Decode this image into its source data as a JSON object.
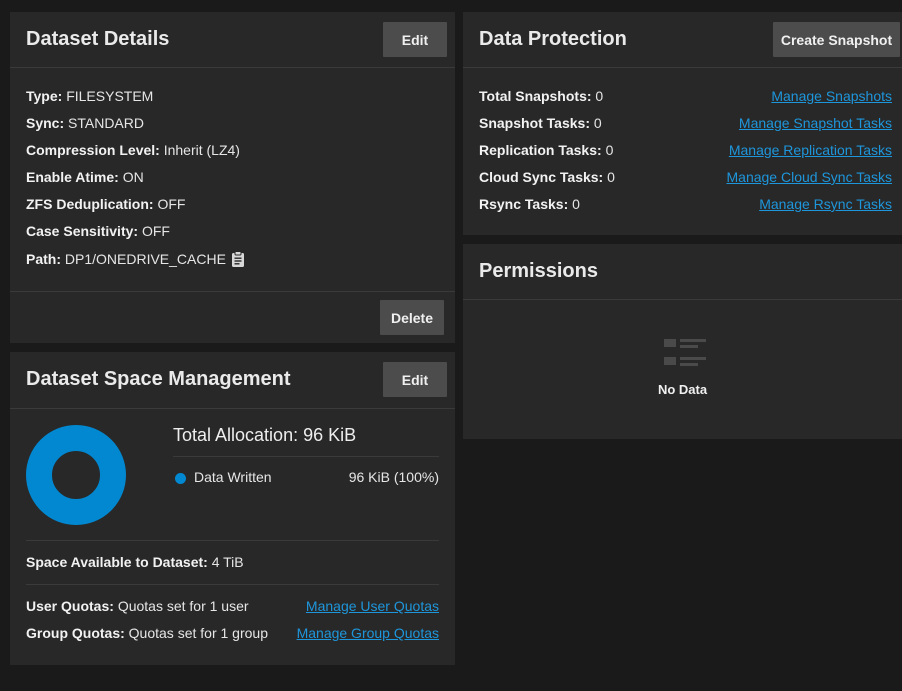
{
  "details": {
    "title": "Dataset Details",
    "edit_label": "Edit",
    "delete_label": "Delete",
    "rows": [
      {
        "label": "Type:",
        "value": "FILESYSTEM"
      },
      {
        "label": "Sync:",
        "value": "STANDARD"
      },
      {
        "label": "Compression Level:",
        "value": "Inherit (LZ4)"
      },
      {
        "label": "Enable Atime:",
        "value": "ON"
      },
      {
        "label": "ZFS Deduplication:",
        "value": "OFF"
      },
      {
        "label": "Case Sensitivity:",
        "value": "OFF"
      },
      {
        "label": "Path:",
        "value": "DP1/ONEDRIVE_CACHE"
      }
    ]
  },
  "space": {
    "title": "Dataset Space Management",
    "edit_label": "Edit",
    "total_label": "Total Allocation:",
    "total_value": "96 KiB",
    "legend_label": "Data Written",
    "legend_value": "96 KiB (100%)",
    "legend_fraction": 1.0,
    "available_label": "Space Available to Dataset:",
    "available_value": "4 TiB",
    "user_quota_label": "User Quotas:",
    "user_quota_value": "Quotas set for 1 user",
    "user_quota_link": "Manage User Quotas",
    "group_quota_label": "Group Quotas:",
    "group_quota_value": "Quotas set for 1 group",
    "group_quota_link": "Manage Group Quotas"
  },
  "protection": {
    "title": "Data Protection",
    "create_snapshot_label": "Create Snapshot",
    "rows": [
      {
        "label": "Total Snapshots:",
        "value": "0",
        "link": "Manage Snapshots"
      },
      {
        "label": "Snapshot Tasks:",
        "value": "0",
        "link": "Manage Snapshot Tasks"
      },
      {
        "label": "Replication Tasks:",
        "value": "0",
        "link": "Manage Replication Tasks"
      },
      {
        "label": "Cloud Sync Tasks:",
        "value": "0",
        "link": "Manage Cloud Sync Tasks"
      },
      {
        "label": "Rsync Tasks:",
        "value": "0",
        "link": "Manage Rsync Tasks"
      }
    ]
  },
  "permissions": {
    "title": "Permissions",
    "empty_text": "No Data"
  },
  "colors": {
    "accent": "#0288d1",
    "link": "#1e96db",
    "card": "#282828",
    "background": "#1a1a1a"
  }
}
